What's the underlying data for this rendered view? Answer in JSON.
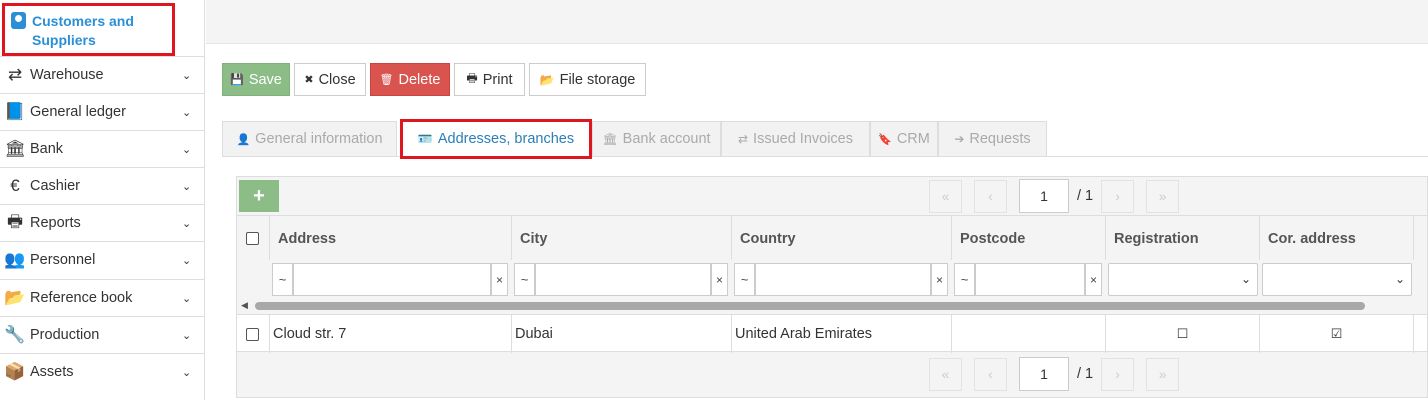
{
  "sidebar": {
    "active_label": "Customers and Suppliers",
    "items": [
      {
        "label": "Warehouse",
        "icon": "⇄"
      },
      {
        "label": "General ledger",
        "icon": "📘"
      },
      {
        "label": "Bank",
        "icon": "🏛"
      },
      {
        "label": "Cashier",
        "icon": "€"
      },
      {
        "label": "Reports",
        "icon": "🖶"
      },
      {
        "label": "Personnel",
        "icon": "👥"
      },
      {
        "label": "Reference book",
        "icon": "📂"
      },
      {
        "label": "Production",
        "icon": "🔧"
      },
      {
        "label": "Assets",
        "icon": "📦"
      }
    ]
  },
  "toolbar": {
    "save": "Save",
    "save_icon": "💾",
    "close": "Close",
    "close_icon": "✖",
    "delete": "Delete",
    "delete_icon": "🗑",
    "print": "Print",
    "print_icon": "🖶",
    "file_storage": "File storage",
    "file_storage_icon": "📂"
  },
  "tabs": [
    {
      "label": "General information",
      "icon": "👤"
    },
    {
      "label": "Addresses, branches",
      "icon": "🪪"
    },
    {
      "label": "Bank account",
      "icon": "🏛"
    },
    {
      "label": "Issued Invoices",
      "icon": "⇄"
    },
    {
      "label": "CRM",
      "icon": "🔖"
    },
    {
      "label": "Requests",
      "icon": "➔"
    }
  ],
  "grid": {
    "add_label": "+",
    "pager": {
      "first": "«",
      "prev": "‹",
      "page": "1",
      "total": "/ 1",
      "next": "›",
      "last": "»"
    },
    "columns": [
      "Address",
      "City",
      "Country",
      "Postcode",
      "Registration",
      "Cor. address"
    ],
    "filter_tilde": "~",
    "filter_clear": "×",
    "select_arrow": "⌄",
    "rows": [
      {
        "address": "Cloud str. 7",
        "city": "Dubai",
        "country": "United Arab Emirates",
        "postcode": "",
        "registration": "☐",
        "cor_address": "☑"
      }
    ]
  }
}
